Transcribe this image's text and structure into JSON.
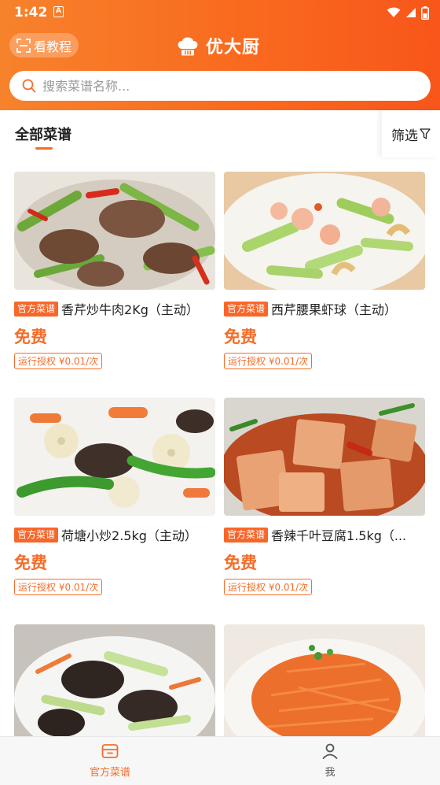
{
  "status_bar": {
    "time": "1:42",
    "badge_letter": "A"
  },
  "header": {
    "tutorial_label": "看教程",
    "app_name": "优大厨",
    "accent_color": "#f96a1f"
  },
  "search": {
    "placeholder": "搜索菜谱名称..."
  },
  "tabs": {
    "all_label": "全部菜谱",
    "filter_label": "筛选"
  },
  "recipes": [
    {
      "badge": "官方菜谱",
      "title": "香芹炒牛肉2Kg（主动）",
      "price": "免费",
      "auth": "运行授权 ¥0.01/次"
    },
    {
      "badge": "官方菜谱",
      "title": "西芹腰果虾球（主动）",
      "price": "免费",
      "auth": "运行授权 ¥0.01/次"
    },
    {
      "badge": "官方菜谱",
      "title": "荷塘小炒2.5kg（主动）",
      "price": "免费",
      "auth": "运行授权 ¥0.01/次"
    },
    {
      "badge": "官方菜谱",
      "title": "香辣千叶豆腐1.5kg（...",
      "price": "免费",
      "auth": "运行授权 ¥0.01/次"
    },
    {
      "badge": "",
      "title": "",
      "price": "",
      "auth": ""
    },
    {
      "badge": "",
      "title": "",
      "price": "",
      "auth": ""
    }
  ],
  "bottom_nav": {
    "recipes_label": "官方菜谱",
    "me_label": "我",
    "active_color": "#f46d2a"
  }
}
